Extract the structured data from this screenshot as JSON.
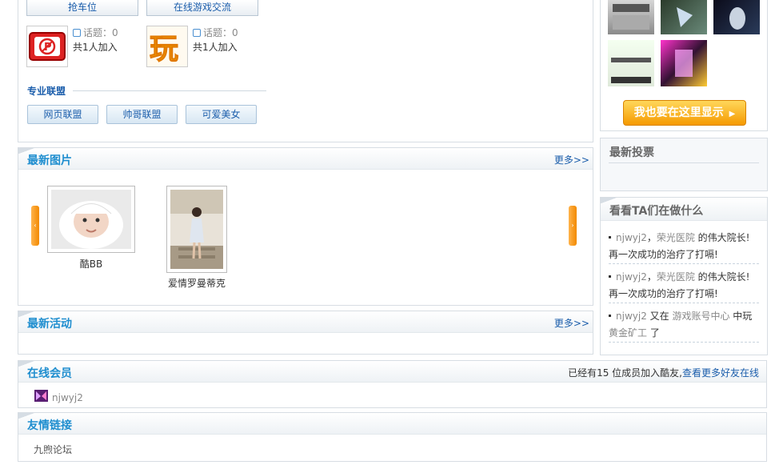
{
  "groups": {
    "tabs": [
      "抢车位",
      "在线游戏交流"
    ],
    "items": [
      {
        "topic_label": "话题：0",
        "members": "共1人加入",
        "icon": "parking-sign-icon"
      },
      {
        "topic_label": "话题：0",
        "members": "共1人加入",
        "icon": "play-character-icon"
      }
    ]
  },
  "alliance": {
    "title": "专业联盟",
    "buttons": [
      "网页联盟",
      "帅哥联盟",
      "可爱美女"
    ]
  },
  "photos": {
    "title": "最新图片",
    "more": "更多>>",
    "items": [
      {
        "caption": "酷BB"
      },
      {
        "caption": "爱情罗曼蒂克"
      }
    ]
  },
  "activities": {
    "title": "最新活动",
    "more": "更多>>"
  },
  "online": {
    "title": "在线会员",
    "summary_prefix": "已经有15 位成员加入酷友,",
    "summary_link": "查看更多好友在线",
    "members": [
      "njwyj2"
    ]
  },
  "links": {
    "title": "友情链接",
    "items": [
      "九煦论坛"
    ]
  },
  "sidebar": {
    "show_me_button": "我也要在这里显示",
    "vote_title": "最新投票",
    "feed_title": "看看TA们在做什么",
    "feed": [
      {
        "user": "njwyj2",
        "sep": "，",
        "link": "荣光医院",
        "text": " 的伟大院长! 再一次成功的治疗了打嗝!"
      },
      {
        "user": "njwyj2",
        "sep": "，",
        "link": "荣光医院",
        "text": " 的伟大院长! 再一次成功的治疗了打嗝!"
      },
      {
        "user": "njwyj2",
        "pre": " 又在 ",
        "link": "游戏账号中心",
        "mid": " 中玩 ",
        "link2": "黄金矿工",
        "post": " 了"
      }
    ]
  },
  "colors": {
    "title_blue": "#1f8ecf",
    "link_blue": "#1a5dab",
    "orange": "#f28a00"
  }
}
